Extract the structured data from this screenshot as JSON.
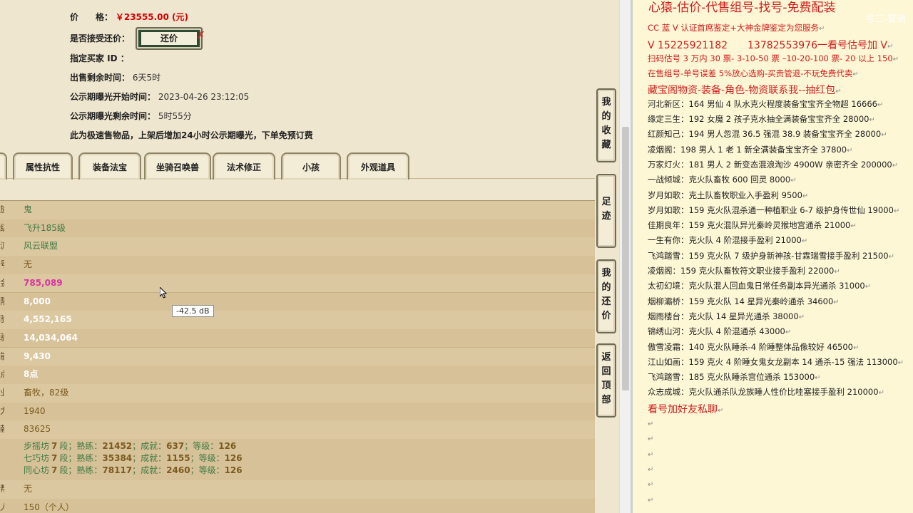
{
  "item_info": {
    "price_label": "价　　格：",
    "price_value": "￥23555.00 (元)",
    "accept_counter_label": "是否接受还价：",
    "counter_button": "还价",
    "buyer_id_label": "指定买家 ID ：",
    "remaining_label": "出售剩余时间：",
    "remaining_value": "6天5时",
    "publicity_start_label": "公示期曝光开始时间：",
    "publicity_start_value": "2023-04-26 23:12:05",
    "publicity_remain_label": "公示期曝光剩余时间：",
    "publicity_remain_value": "5时55分",
    "notice": "此为极速售物品，上架后增加24小时公示期曝光，下单免预订费"
  },
  "tabs": [
    "属性抗性",
    "装备法宝",
    "坐骑召唤兽",
    "法术修正",
    "小孩",
    "外观道具"
  ],
  "table_rows": [
    {
      "label": "族",
      "value": "鬼",
      "style": "green"
    },
    {
      "label": "级",
      "value": "飞升185级",
      "style": "green"
    },
    {
      "label": "派",
      "value": "风云联盟",
      "style": "green"
    },
    {
      "label": "号",
      "value": "无",
      "style": "brown"
    },
    {
      "label": "金",
      "value": "785,089",
      "style": "pink"
    },
    {
      "label": "限",
      "value": "8,000",
      "style": "white"
    },
    {
      "label": "验",
      "value": "4,552,165",
      "style": "white"
    },
    {
      "label": "验",
      "value": "14,034,064",
      "style": "white"
    },
    {
      "label": "能",
      "value": "9,430",
      "style": "white"
    },
    {
      "label": "点",
      "value": "8点",
      "style": "white"
    },
    {
      "label": "业",
      "value": "畜牧，82级",
      "style": "brown"
    },
    {
      "label": "力",
      "value": "1940",
      "style": "brown"
    },
    {
      "label": "献",
      "value": "83625",
      "style": "brown"
    }
  ],
  "workshop_rows": [
    {
      "name": "步摇坊",
      "grade": "7",
      "skill": "21452",
      "achieve": "637",
      "level": "126"
    },
    {
      "name": "七巧坊",
      "grade": "7",
      "skill": "35384",
      "achieve": "1155",
      "level": "126"
    },
    {
      "name": "同心坊",
      "grade": "7",
      "skill": "78117",
      "achieve": "2460",
      "level": "126"
    }
  ],
  "workshop_labels": {
    "grade_suffix": "段；熟练：",
    "achieve": "；成就：",
    "level": "；等级："
  },
  "table_rows_after": [
    {
      "label": "帮",
      "value": "无",
      "style": "brown"
    },
    {
      "label": "人",
      "value": "150（个人）",
      "style": "brown"
    }
  ],
  "tooltip": "-42.5 dB",
  "side_buttons": [
    {
      "chars": [
        "我",
        "的",
        "收",
        "藏"
      ]
    },
    {
      "chars": [
        "足",
        "迹"
      ]
    },
    {
      "chars": [
        "我",
        "的",
        "还",
        "价"
      ]
    },
    {
      "chars": [
        "返",
        "回",
        "顶",
        "部"
      ]
    }
  ],
  "right_panel": {
    "title": "心猿-估价-代售组号-找号-免费配装",
    "watermark": "号三-亚洲",
    "lines": [
      {
        "text": "CC 蓝 V 认证首席鉴定+大神金牌鉴定为您服务",
        "red": true
      },
      {
        "text": "V 15225921182　　13782553976一看号估号加 V",
        "red": true,
        "big": true
      },
      {
        "text": "扫码估号 3 万内 30 票- 3-10-50 票 –10-20-100 票- 20 以上 150",
        "red": true
      },
      {
        "text": "在售组号-单号误差 5%放心选购-买贵管退-不玩免费代卖",
        "red": true
      },
      {
        "text": "藏宝阁物资-装备-角色-物资联系我--抽红包",
        "red": true,
        "big": true
      },
      {
        "text": "河北新区：164 男仙 4 队水克火程度装备宝宝齐全物超 16666"
      },
      {
        "text": "缘定三生：192 女魔 2 孩子克水抽全满装备宝宝齐全 28000"
      },
      {
        "text": "红颜知己：194 男人忽混 36.5 强混 38.9 装备宝宝齐全 28000"
      },
      {
        "text": "凌烟阁：198 男人 1 老 1 新全满装备宝宝齐全 37800"
      },
      {
        "text": "万家灯火：181 男人 2 新变态混浪淘沙 4900W 亲密齐全 200000"
      },
      {
        "text": "一战倾城：克火队畜牧 600 回灵 8000"
      },
      {
        "text": "岁月如歌：克土队畜牧职业入手盈利 9500"
      },
      {
        "text": "岁月如歌：159 克火队混杀通一种植职业 6-7 级护身传世仙 19000"
      },
      {
        "text": "佳期良年：159 克火混队异光秦岭灵猴地宫通杀 21000"
      },
      {
        "text": "一生有你：克火队 4 阶混接手盈利 21000"
      },
      {
        "text": "飞鸿踏雪：159 克火队 7 级护身新神孩-甘霖瑞雪接手盈利 21500"
      },
      {
        "text": "凌烟阁：159 克火队畜牧符文职业接手盈利 22000"
      },
      {
        "text": "太初幻境：克火队混人回血鬼日常任务副本异光通杀 31000"
      },
      {
        "text": "烟柳灞桥：159 克火队 14 星异光秦岭通杀 34600"
      },
      {
        "text": "烟雨楼台：克火队 14 星异光通杀 38000"
      },
      {
        "text": "锦绣山河：克火队 4 阶混通杀 43000"
      },
      {
        "text": "傲雪凌霜：140 克火队睡杀-4 阶睡整体品像较好 46500"
      },
      {
        "text": "江山如画：159 克火 4 阶睡女鬼女龙副本 14 通杀-15 强法 113000"
      },
      {
        "text": "飞鸿踏雪：185 克火队睡杀宫位通杀 153000"
      },
      {
        "text": "众志成城：克火队通杀队龙族睡人性价比哇塞接手盈利 210000"
      },
      {
        "text": "看号加好友私聊",
        "red": true,
        "big": true
      }
    ],
    "return_mark": "↵"
  }
}
